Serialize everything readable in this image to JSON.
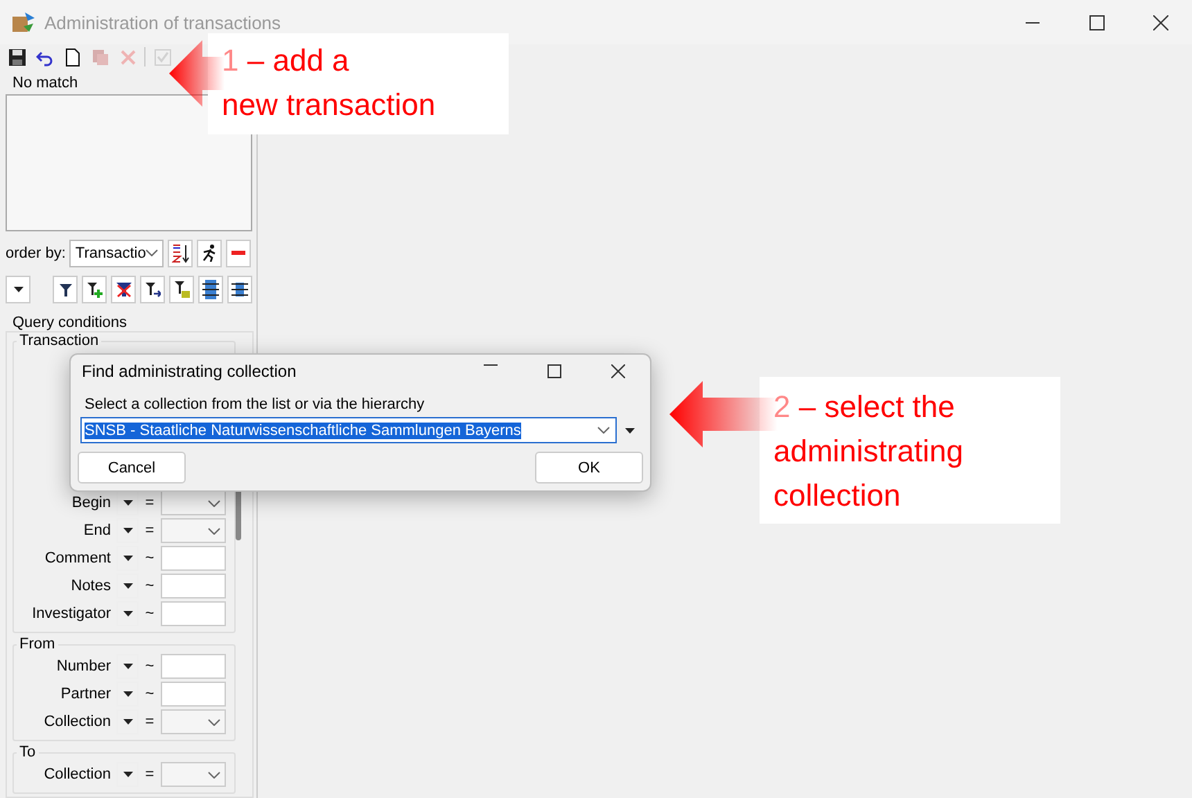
{
  "window": {
    "title": "Administration of transactions"
  },
  "toolbar": [
    {
      "kind": "save",
      "disabled": false
    },
    {
      "kind": "undo",
      "disabled": false
    },
    {
      "kind": "new",
      "disabled": false
    },
    {
      "kind": "copy",
      "disabled": true
    },
    {
      "kind": "delete",
      "disabled": true
    },
    {
      "kind": "check",
      "disabled": true
    }
  ],
  "status": "No match",
  "order_by": {
    "label": "order by:",
    "value": "Transactio"
  },
  "query": {
    "title": "Query conditions",
    "groups": [
      {
        "title": "Transaction",
        "rows": [
          {
            "label": "Begin",
            "operator": "=",
            "kind": "combo"
          },
          {
            "label": "End",
            "operator": "=",
            "kind": "combo"
          },
          {
            "label": "Comment",
            "operator": "~",
            "kind": "text"
          },
          {
            "label": "Notes",
            "operator": "~",
            "kind": "text"
          },
          {
            "label": "Investigator",
            "operator": "~",
            "kind": "text"
          }
        ]
      },
      {
        "title": "From",
        "rows": [
          {
            "label": "Number",
            "operator": "~",
            "kind": "text"
          },
          {
            "label": "Partner",
            "operator": "~",
            "kind": "text"
          },
          {
            "label": "Collection",
            "operator": "=",
            "kind": "combo"
          }
        ]
      },
      {
        "title": "To",
        "rows": [
          {
            "label": "Collection",
            "operator": "=",
            "kind": "combo"
          }
        ]
      }
    ]
  },
  "dialog": {
    "title": "Find administrating collection",
    "prompt": "Select a collection from the list or via the hierarchy",
    "value": "SNSB - Staatliche Naturwissenschaftliche Sammlungen Bayerns",
    "buttons": [
      "Cancel",
      "OK"
    ]
  },
  "callouts": [
    {
      "number": "1",
      "lines": [
        "– add a",
        "new transaction"
      ]
    },
    {
      "number": "2",
      "lines": [
        "– select the",
        "administrating",
        "collection"
      ]
    }
  ]
}
